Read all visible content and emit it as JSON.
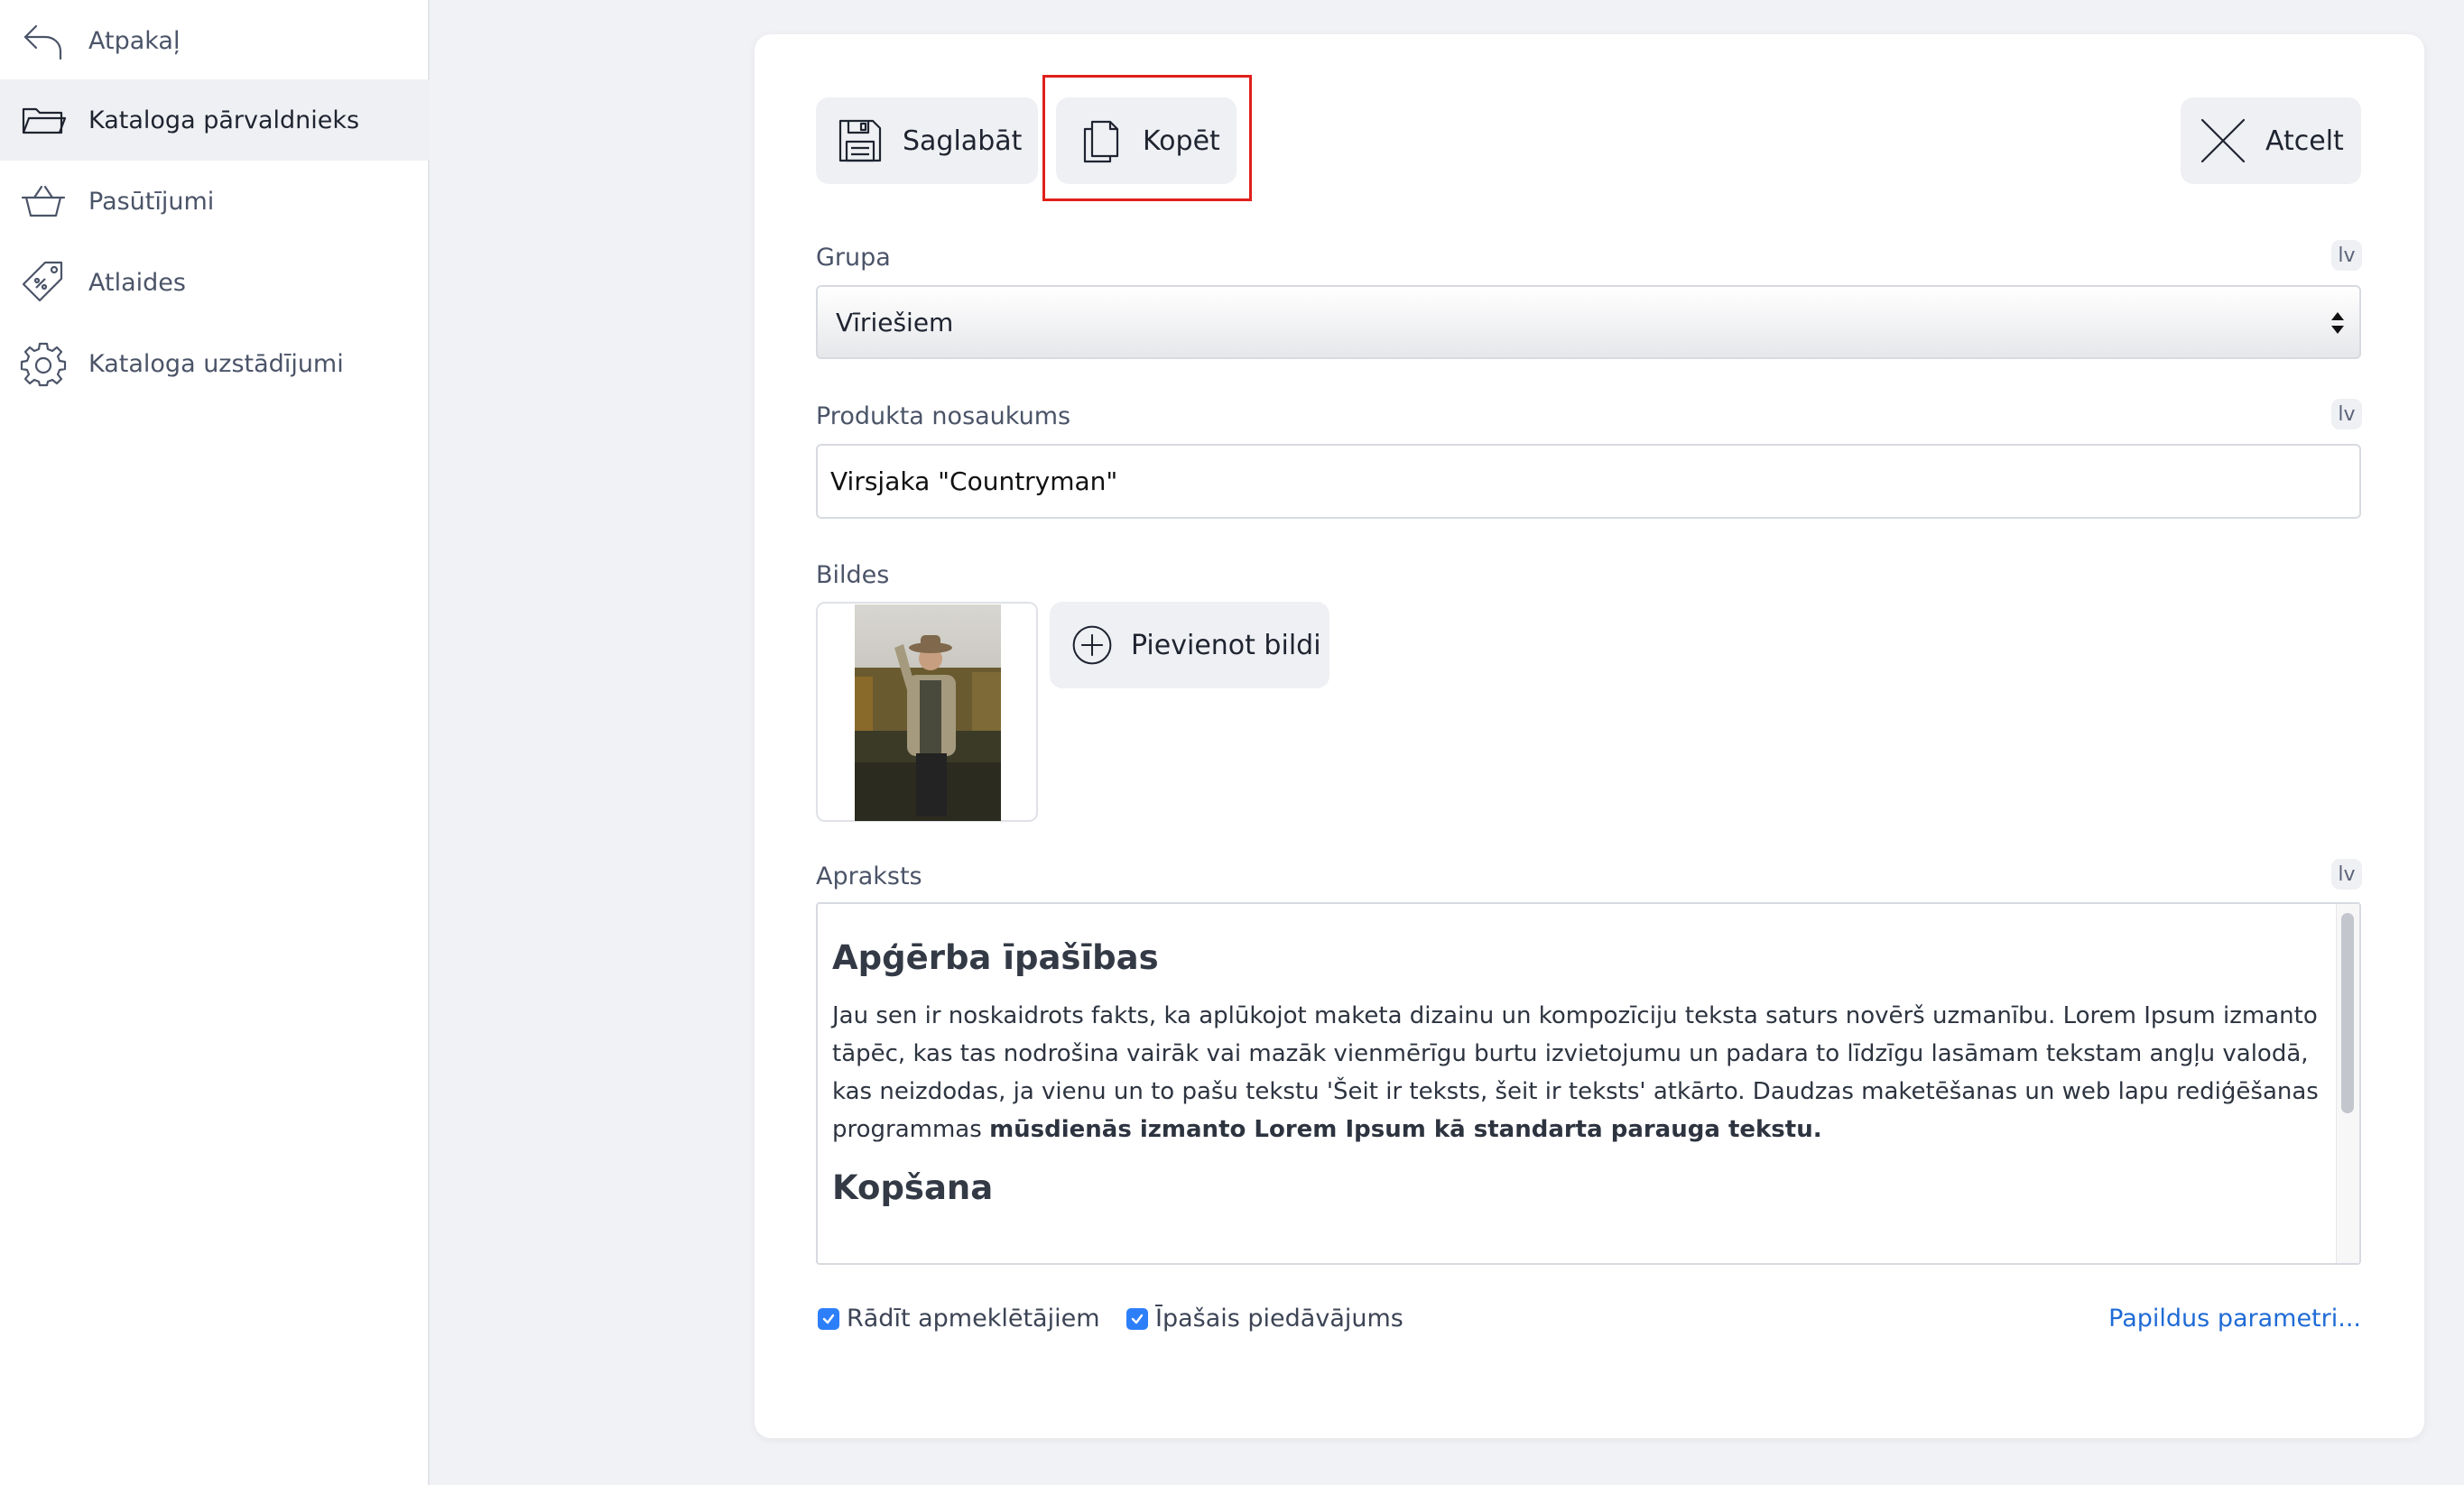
{
  "sidebar": {
    "items": [
      {
        "label": "Atpakaļ",
        "icon": "back-arrow-icon"
      },
      {
        "label": "Kataloga pārvaldnieks",
        "icon": "folder-icon",
        "active": true
      },
      {
        "label": "Pasūtījumi",
        "icon": "basket-icon"
      },
      {
        "label": "Atlaides",
        "icon": "discount-tag-icon"
      },
      {
        "label": "Kataloga uzstādījumi",
        "icon": "gear-icon"
      }
    ]
  },
  "toolbar": {
    "save_label": "Saglabāt",
    "copy_label": "Kopēt",
    "cancel_label": "Atcelt"
  },
  "form": {
    "group": {
      "label": "Grupa",
      "lang": "lv",
      "value": "Vīriešiem"
    },
    "name": {
      "label": "Produkta nosaukums",
      "lang": "lv",
      "value": "Virsjaka \"Countryman\""
    },
    "images": {
      "label": "Bildes",
      "add_label": "Pievienot bildi"
    },
    "description": {
      "label": "Apraksts",
      "lang": "lv",
      "heading1": "Apģērba īpašības",
      "paragraph_text": "Jau sen ir noskaidrots fakts, ka aplūkojot maketa dizainu un kompozīciju teksta saturs novērš uzmanību. Lorem Ipsum izmanto tāpēc, kas tas nodrošina vairāk vai mazāk vienmērīgu burtu izvietojumu un padara to līdzīgu lasāmam tekstam angļu valodā, kas neizdodas, ja vienu un to pašu tekstu 'Šeit ir teksts, šeit ir teksts' atkārto. Daudzas maketēšanas un web lapu rediģēšanas programmas",
      "paragraph_bold": "mūsdienās izmanto Lorem Ipsum kā standarta parauga tekstu.",
      "heading2": "Kopšana"
    },
    "checkboxes": [
      {
        "label": "Rādīt apmeklētājiem",
        "checked": true
      },
      {
        "label": "Īpašais piedāvājums",
        "checked": true
      }
    ],
    "more_link": "Papildus parametri..."
  },
  "colors": {
    "accent": "#2d7ff9",
    "link": "#1f6bd6",
    "highlight": "#e0201b"
  }
}
